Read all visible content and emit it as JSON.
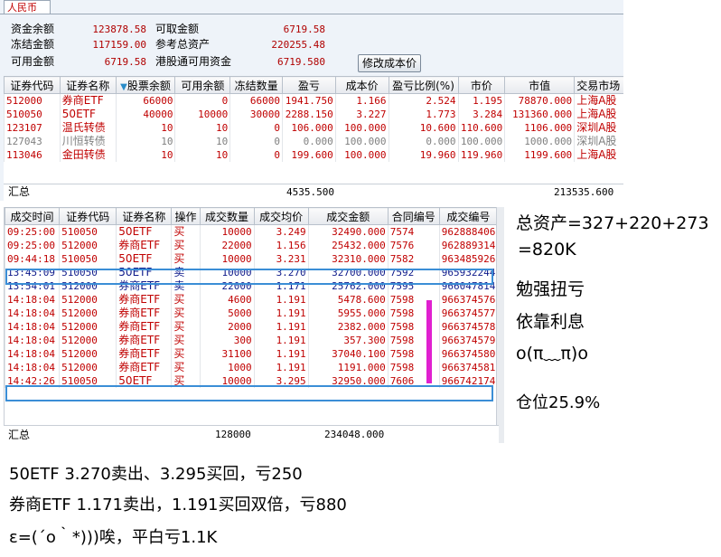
{
  "account": {
    "tab": "人民币",
    "button_modify_cost": "修改成本价",
    "rows": [
      [
        {
          "label": "资金余额",
          "value": "123878.58"
        },
        {
          "label": "可取金额",
          "value": "6719.58"
        }
      ],
      [
        {
          "label": "冻结金额",
          "value": "117159.00"
        },
        {
          "label": "参考总资产",
          "value": "220255.48"
        }
      ],
      [
        {
          "label": "可用金额",
          "value": "6719.58"
        },
        {
          "label": "港股通可用资金",
          "value": "6719.580"
        }
      ]
    ]
  },
  "positions": {
    "columns": [
      "证券代码",
      "证券名称",
      "股票余额",
      "可用余额",
      "冻结数量",
      "盈亏",
      "成本价",
      "盈亏比例(%)",
      "市价",
      "市值",
      "交易市场"
    ],
    "sorted_column": "股票余额",
    "rows": [
      {
        "code": "512000",
        "name": "券商ETF",
        "bal": "66000",
        "avail": "0",
        "frozen": "66000",
        "pnl": "1941.750",
        "cost": "1.166",
        "pct": "2.524",
        "price": "1.195",
        "value": "78870.000",
        "market": "上海A股",
        "color": "red"
      },
      {
        "code": "510050",
        "name": "50ETF",
        "bal": "40000",
        "avail": "10000",
        "frozen": "30000",
        "pnl": "2288.150",
        "cost": "3.227",
        "pct": "1.773",
        "price": "3.284",
        "value": "131360.000",
        "market": "上海A股",
        "color": "red"
      },
      {
        "code": "123107",
        "name": "温氏转债",
        "bal": "10",
        "avail": "10",
        "frozen": "0",
        "pnl": "106.000",
        "cost": "100.000",
        "pct": "10.600",
        "price": "110.600",
        "value": "1106.000",
        "market": "深圳A股",
        "color": "red"
      },
      {
        "code": "127043",
        "name": "川恒转债",
        "bal": "10",
        "avail": "10",
        "frozen": "0",
        "pnl": "0.000",
        "cost": "100.000",
        "pct": "0.000",
        "price": "100.000",
        "value": "1000.000",
        "market": "深圳A股",
        "color": "gray"
      },
      {
        "code": "113046",
        "name": "金田转债",
        "bal": "10",
        "avail": "10",
        "frozen": "0",
        "pnl": "199.600",
        "cost": "100.000",
        "pct": "19.960",
        "price": "119.960",
        "value": "1199.600",
        "market": "上海A股",
        "color": "red"
      }
    ],
    "total_label": "汇总",
    "total_pnl": "4535.500",
    "total_value": "213535.600"
  },
  "trades": {
    "columns": [
      "成交时间",
      "证券代码",
      "证券名称",
      "操作",
      "成交数量",
      "成交均价",
      "成交金额",
      "合同编号",
      "成交编号"
    ],
    "rows": [
      {
        "time": "09:25:00",
        "code": "510050",
        "name": "50ETF",
        "op": "买",
        "qty": "10000",
        "price": "3.249",
        "amount": "32490.000",
        "contract": "7574",
        "trade_no": "962888406",
        "color": "red"
      },
      {
        "time": "09:25:00",
        "code": "512000",
        "name": "券商ETF",
        "op": "买",
        "qty": "22000",
        "price": "1.156",
        "amount": "25432.000",
        "contract": "7576",
        "trade_no": "962889314",
        "color": "red"
      },
      {
        "time": "09:44:18",
        "code": "510050",
        "name": "50ETF",
        "op": "买",
        "qty": "10000",
        "price": "3.231",
        "amount": "32310.000",
        "contract": "7582",
        "trade_no": "963485926",
        "color": "red"
      },
      {
        "time": "13:45:09",
        "code": "510050",
        "name": "50ETF",
        "op": "卖",
        "qty": "10000",
        "price": "3.270",
        "amount": "32700.000",
        "contract": "7592",
        "trade_no": "965932244",
        "color": "navy"
      },
      {
        "time": "13:54:01",
        "code": "512000",
        "name": "券商ETF",
        "op": "卖",
        "qty": "22000",
        "price": "1.171",
        "amount": "25762.000",
        "contract": "7595",
        "trade_no": "966047814",
        "color": "navy"
      },
      {
        "time": "14:18:04",
        "code": "512000",
        "name": "券商ETF",
        "op": "买",
        "qty": "4600",
        "price": "1.191",
        "amount": "5478.600",
        "contract": "7598",
        "trade_no": "966374576",
        "color": "red"
      },
      {
        "time": "14:18:04",
        "code": "512000",
        "name": "券商ETF",
        "op": "买",
        "qty": "5000",
        "price": "1.191",
        "amount": "5955.000",
        "contract": "7598",
        "trade_no": "966374577",
        "color": "red"
      },
      {
        "time": "14:18:04",
        "code": "512000",
        "name": "券商ETF",
        "op": "买",
        "qty": "2000",
        "price": "1.191",
        "amount": "2382.000",
        "contract": "7598",
        "trade_no": "966374578",
        "color": "red"
      },
      {
        "time": "14:18:04",
        "code": "512000",
        "name": "券商ETF",
        "op": "买",
        "qty": "300",
        "price": "1.191",
        "amount": "357.300",
        "contract": "7598",
        "trade_no": "966374579",
        "color": "red"
      },
      {
        "time": "14:18:04",
        "code": "512000",
        "name": "券商ETF",
        "op": "买",
        "qty": "31100",
        "price": "1.191",
        "amount": "37040.100",
        "contract": "7598",
        "trade_no": "966374580",
        "color": "red"
      },
      {
        "time": "14:18:04",
        "code": "512000",
        "name": "券商ETF",
        "op": "买",
        "qty": "1000",
        "price": "1.191",
        "amount": "1191.000",
        "contract": "7598",
        "trade_no": "966374581",
        "color": "red"
      },
      {
        "time": "14:42:26",
        "code": "510050",
        "name": "50ETF",
        "op": "买",
        "qty": "10000",
        "price": "3.295",
        "amount": "32950.000",
        "contract": "7606",
        "trade_no": "966742174",
        "color": "red"
      }
    ],
    "total_label": "汇总",
    "total_qty": "128000",
    "total_amount": "234048.000"
  },
  "annotations": {
    "right": [
      "总资产=327+220+273",
      "=820K",
      "勉强扭亏",
      "依靠利息",
      "o(π﹏π)o",
      "仓位25.9%"
    ],
    "bottom": [
      "50ETF 3.270卖出、3.295买回，亏250",
      "券商ETF 1.171卖出，1.191买回双倍，亏880",
      "ε=(´ο｀*)))唉，平白亏1.1K"
    ]
  },
  "colors": {
    "red": "#c00000",
    "navy": "#0e1a8a",
    "gray": "#7f7f7f",
    "highlight_box": "#3b8ed6",
    "marker": "#e020d0"
  }
}
